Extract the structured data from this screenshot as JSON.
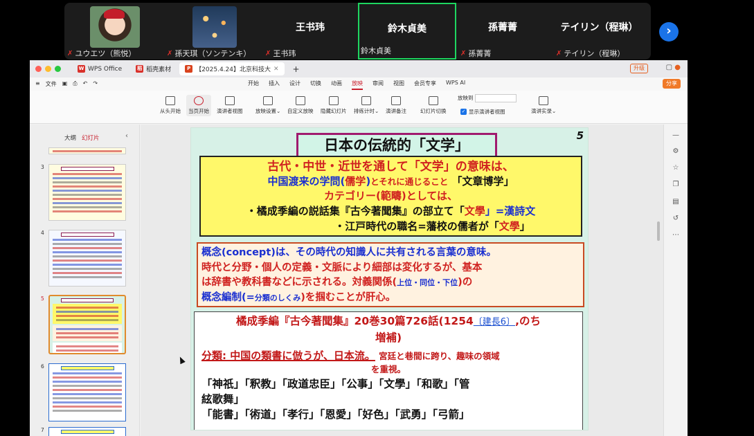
{
  "participants": [
    {
      "name": "ユウエツ（熊悦）",
      "muted": true
    },
    {
      "name": "孫天琪（ソンテンキ）",
      "muted": true
    },
    {
      "name": "王书玮",
      "display": "王书玮",
      "muted": true
    },
    {
      "name": "鈴木貞美",
      "display": "鈴木貞美",
      "muted": false,
      "active": true
    },
    {
      "name": "孫菁菁",
      "display": "孫菁菁",
      "muted": true
    },
    {
      "name": "テイリン（程琳）",
      "display": "テイリン（程琳）",
      "muted": true
    }
  ],
  "wps": {
    "tabs": [
      {
        "label": "WPS Office",
        "icon": "W",
        "color": "#d9312b"
      },
      {
        "label": "稻壳素材",
        "icon": "稻",
        "color": "#d9312b"
      },
      {
        "label": "【2025.4.24】北京科技大",
        "icon": "P",
        "color": "#d9431e"
      }
    ],
    "upgrade": "升级",
    "file_menu": "文件",
    "menu": [
      "开始",
      "插入",
      "设计",
      "切换",
      "动画",
      "放映",
      "审阅",
      "视图",
      "会员专享",
      "WPS AI"
    ],
    "menu_selected": "放映",
    "share": "分享",
    "ribbon": [
      "从头开始",
      "当页开始",
      "演讲者视图",
      "放映设置",
      "自定义放映",
      "隐藏幻灯片",
      "排练计时",
      "演讲备注",
      "幻灯片切换",
      "演讲实录"
    ],
    "play_to_label": "放映到",
    "presenter_view_check": "显示演讲者视图",
    "panel_tabs": [
      "大纲",
      "幻灯片"
    ],
    "panel_selected": "幻灯片",
    "thumb_numbers": [
      "3",
      "4",
      "5",
      "6",
      "7"
    ]
  },
  "slide": {
    "number": "5",
    "title": "日本の伝統的「文学」",
    "box1": {
      "line1": "古代・中世・近世を通して「文学」の意味は、",
      "line2_a": "中国渡来の学問(",
      "line2_b": "儒学",
      "line2_c": ")",
      "line2_d": "とそれに通じること",
      "line2_e": "「文章博学」",
      "line3": "カテゴリー(範疇)としては、",
      "line4_a": "・橘成季編の説話集『古今著聞集』の部立て「",
      "line4_b": "文學",
      "line4_c": "」=漢詩文",
      "line5_a": "・江戸時代の職名=藩校の儒者が「",
      "line5_b": "文學",
      "line5_c": "」"
    },
    "box2": {
      "l1": "概念(concept)は、その時代の知識人に共有される言葉の意味。",
      "l2": "時代と分野・個人の定義・文脈により細部は変化するが、基本",
      "l3_a": "は辞書や教科書などに示される。対義関係(",
      "l3_b": "上位・同位・下位",
      "l3_c": ")の",
      "l4_a": "概念編制(=",
      "l4_b": "分類のしくみ",
      "l4_c": ")を掴むことが肝心。"
    },
    "box3": {
      "a1": "橘成季編『古今著聞集』20巻30篇726話(1254",
      "a_link": "〔建長6〕",
      "a2": ",のち",
      "a3": "増補)",
      "c1": "分類: 中国の類書に倣うが、日本流。",
      "c2": "宮廷と巷間に跨り、趣味の領域",
      "c3": "を重視。",
      "d1": "「神祇」「釈教」「政道忠臣」「公事」「文學」「和歌」「管",
      "d2": "絃歌舞」",
      "d3": "「能書」「術道」「孝行」「恩愛」「好色」「武勇」「弓箭」"
    }
  }
}
